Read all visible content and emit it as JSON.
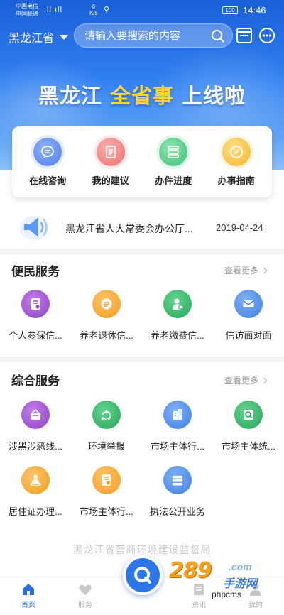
{
  "status_bar": {
    "carrier_1": "中国电信",
    "carrier_2": "中国联通",
    "signal": "ıll ıll",
    "net_speed_value": "0",
    "net_speed_unit": "K/s",
    "battery": "100",
    "time": "14:46"
  },
  "header": {
    "province": "黑龙江省",
    "search_placeholder": "请输入要搜索的内容",
    "banner_part1": "黑龙江 ",
    "banner_highlight": "全省事",
    "banner_part2": " 上线啦"
  },
  "quick_actions": [
    {
      "label": "在线咨询",
      "icon": "chat-icon",
      "color": "#4b7ce8"
    },
    {
      "label": "我的建议",
      "icon": "document-icon",
      "color": "#ef6b6b"
    },
    {
      "label": "办件进度",
      "icon": "progress-icon",
      "color": "#3dbf73"
    },
    {
      "label": "办事指南",
      "icon": "compass-icon",
      "color": "#f5b323"
    }
  ],
  "notice": {
    "icon": "speaker-icon",
    "text": "黑龙江省人大常委会办公厅...",
    "date": "2019-04-24"
  },
  "convenience": {
    "title": "便民服务",
    "more": "查看更多",
    "items": [
      {
        "label": "个人参保信...",
        "icon": "insurance-doc-icon",
        "color": "#8e44c8"
      },
      {
        "label": "养老退休信...",
        "icon": "pension-list-icon",
        "color": "#f39c1f"
      },
      {
        "label": "养老缴费信...",
        "icon": "person-payment-icon",
        "color": "#27a85b"
      },
      {
        "label": "信访面对面",
        "icon": "envelope-icon",
        "color": "#3f7fe2"
      }
    ]
  },
  "comprehensive": {
    "title": "综合服务",
    "more": "查看更多",
    "items": [
      {
        "label": "涉黑涉恶线...",
        "icon": "report-box-icon",
        "color": "#8e44c8"
      },
      {
        "label": "环境举报",
        "icon": "recycle-icon",
        "color": "#27a85b"
      },
      {
        "label": "市场主体行...",
        "icon": "building-icon",
        "color": "#3f7fe2"
      },
      {
        "label": "市场主体统...",
        "icon": "magnifier-doc-icon",
        "color": "#27a85b"
      },
      {
        "label": "居住证办理...",
        "icon": "resident-person-icon",
        "color": "#f39c1f"
      },
      {
        "label": "市场主体行...",
        "icon": "market-doc-icon",
        "color": "#f39c1f"
      },
      {
        "label": "执法公开业务",
        "icon": "books-icon",
        "color": "#3f7fe2"
      }
    ]
  },
  "footer_org": "黑龙江省营商环境建设监督局",
  "bottom_nav": [
    {
      "label": "首页",
      "icon": "home-icon",
      "active": true
    },
    {
      "label": "服务",
      "icon": "heart-icon",
      "active": false
    },
    {
      "label": "资讯",
      "icon": "news-icon",
      "active": false
    },
    {
      "label": "我的",
      "icon": "profile-icon",
      "active": false
    }
  ],
  "watermark": {
    "brand_number": "289",
    "brand_domain": ".com",
    "brand_name": "手游网",
    "site": "phpcms"
  },
  "colors": {
    "header_blue": "#2f7ff0",
    "banner_highlight": "#ffd43b",
    "nav_active": "#2a6fe0"
  }
}
